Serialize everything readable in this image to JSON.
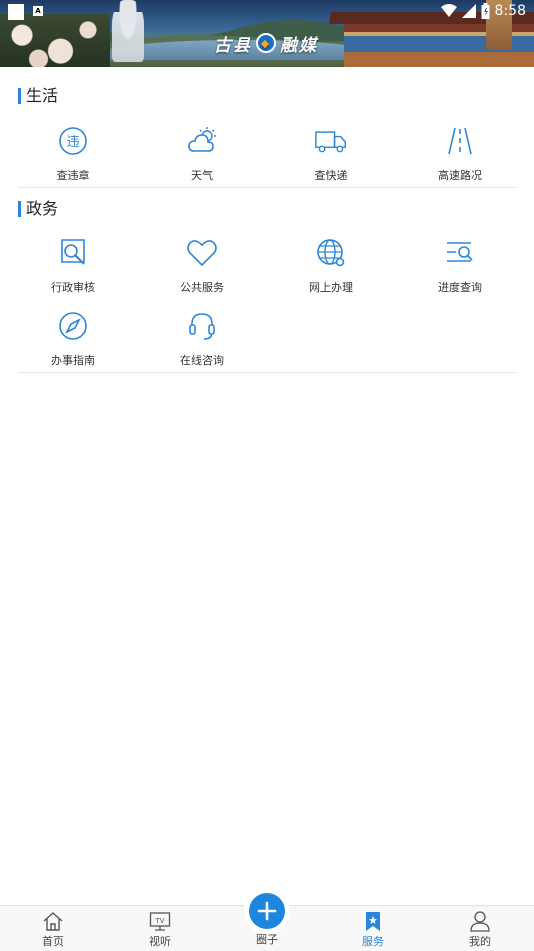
{
  "status_bar": {
    "time": "8:58",
    "notification_badge": "A",
    "icons": [
      "wifi-icon",
      "cell-signal-icon",
      "battery-icon"
    ]
  },
  "header": {
    "brand_left": "古县",
    "brand_right": "融媒"
  },
  "sections": [
    {
      "title": "生活",
      "items": [
        {
          "label": "查违章",
          "icon": "violation-icon",
          "glyph": "违"
        },
        {
          "label": "天气",
          "icon": "weather-icon"
        },
        {
          "label": "查快递",
          "icon": "delivery-truck-icon"
        },
        {
          "label": "高速路况",
          "icon": "highway-icon"
        }
      ]
    },
    {
      "title": "政务",
      "items": [
        {
          "label": "行政审核",
          "icon": "review-search-icon"
        },
        {
          "label": "公共服务",
          "icon": "heart-icon"
        },
        {
          "label": "网上办理",
          "icon": "globe-icon"
        },
        {
          "label": "进度查询",
          "icon": "progress-search-icon"
        },
        {
          "label": "办事指南",
          "icon": "compass-icon"
        },
        {
          "label": "在线咨询",
          "icon": "headset-icon"
        }
      ]
    }
  ],
  "tabbar": {
    "tabs": [
      {
        "label": "首页",
        "icon": "home-icon"
      },
      {
        "label": "视听",
        "icon": "tv-icon",
        "glyph": "TV"
      },
      {
        "label": "圈子",
        "icon": "plus-icon"
      },
      {
        "label": "服务",
        "icon": "service-bookmark-icon",
        "active": true
      },
      {
        "label": "我的",
        "icon": "profile-icon"
      }
    ]
  },
  "colors": {
    "accent": "#2b86d9",
    "icon_stroke": "#2b86d9",
    "fab": "#1f86e0",
    "tabbar_bg": "#f8f8f8",
    "divider": "#e6e6e6"
  }
}
